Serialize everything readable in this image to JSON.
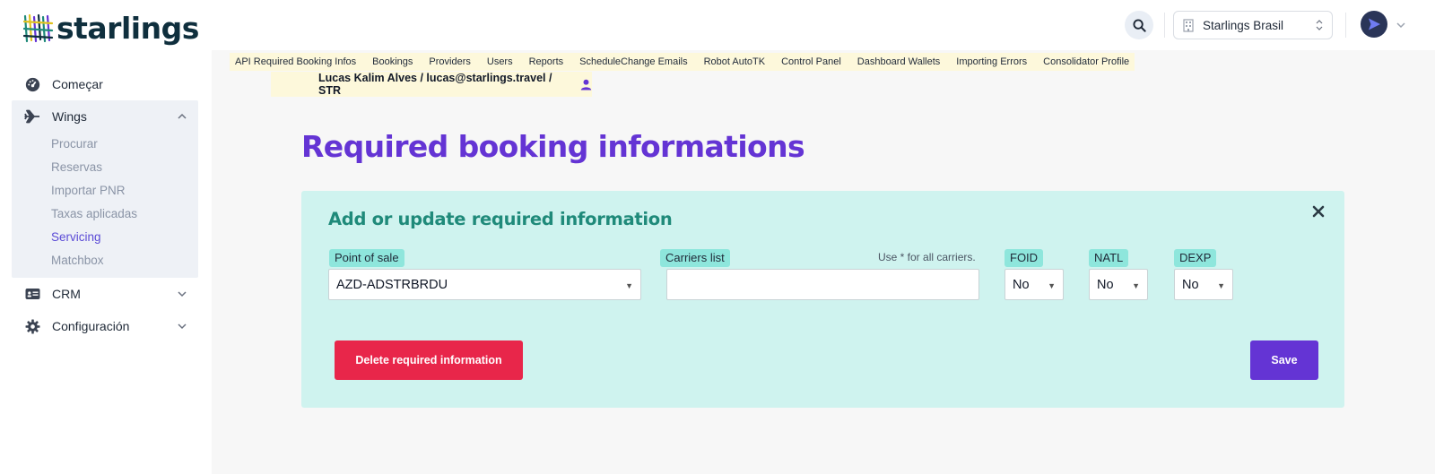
{
  "brand": {
    "name": "starlings",
    "logo_colors": [
      "#0f2f3d",
      "#1f8a7a",
      "#e0c21f",
      "#6434d4"
    ]
  },
  "sidebar": {
    "items": [
      {
        "label": "Começar",
        "icon": "dashboard-icon"
      },
      {
        "label": "Wings",
        "icon": "plane-icon",
        "expanded": true,
        "children": [
          {
            "label": "Procurar"
          },
          {
            "label": "Reservas"
          },
          {
            "label": "Importar PNR"
          },
          {
            "label": "Taxas aplicadas"
          },
          {
            "label": "Servicing",
            "active": true
          },
          {
            "label": "Matchbox"
          }
        ]
      },
      {
        "label": "CRM",
        "icon": "id-card-icon"
      },
      {
        "label": "Configuración",
        "icon": "gear-icon"
      }
    ]
  },
  "topbar": {
    "org_select": "Starlings Brasil"
  },
  "admin_tabs": [
    "API Required Booking Infos",
    "Bookings",
    "Providers",
    "Users",
    "Reports",
    "ScheduleChange Emails",
    "Robot AutoTK",
    "Control Panel",
    "Dashboard Wallets",
    "Importing Errors",
    "Consolidator Profile"
  ],
  "user_line": "Lucas Kalim Alves / lucas@starlings.travel / STR",
  "page": {
    "title": "Required booking informations"
  },
  "form": {
    "title": "Add or update required information",
    "point_of_sale": {
      "label": "Point of sale",
      "value": "AZD-ADSTRBRDU"
    },
    "carriers": {
      "label": "Carriers list",
      "hint": "Use * for all carriers.",
      "value": ""
    },
    "foid": {
      "label": "FOID",
      "value": "No"
    },
    "natl": {
      "label": "NATL",
      "value": "No"
    },
    "dexp": {
      "label": "DEXP",
      "value": "No"
    },
    "delete_label": "Delete required information",
    "save_label": "Save"
  },
  "colors": {
    "accent": "#6434d4",
    "panel_bg": "#cff3ef",
    "label_bg": "#8ee6dc",
    "danger": "#e8264a",
    "tabbar_bg": "#fdf8db"
  }
}
